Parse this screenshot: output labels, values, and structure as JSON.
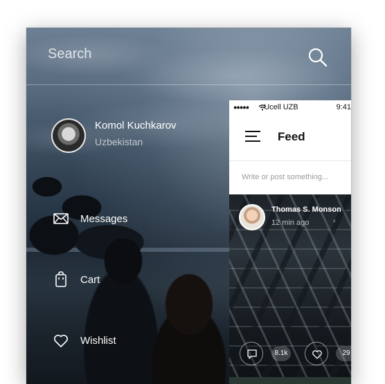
{
  "search": {
    "placeholder": "Search"
  },
  "profile": {
    "name": "Komol Kuchkarov",
    "country": "Uzbekistan"
  },
  "menu": [
    {
      "label": "Messages",
      "icon": "envelope-icon"
    },
    {
      "label": "Cart",
      "icon": "bag-icon"
    },
    {
      "label": "Wishlist",
      "icon": "heart-icon"
    }
  ],
  "feed": {
    "status": {
      "signal": "●●●●●",
      "carrier": "Ucell UZB",
      "time": "9:41"
    },
    "title": "Feed",
    "compose_placeholder": "Write or post something...",
    "post": {
      "author": "Thomas S. Monson",
      "time": "12 min ago",
      "comments": "8.1k",
      "likes": "29"
    }
  }
}
